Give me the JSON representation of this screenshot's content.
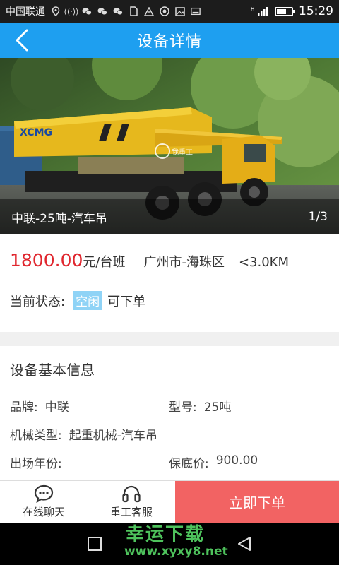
{
  "status_bar": {
    "carrier": "中国联通",
    "time": "15:29"
  },
  "header": {
    "title": "设备详情"
  },
  "photo": {
    "caption": "中联-25吨-汽车吊",
    "page_indicator": "1/3",
    "crane_logo": "XCMG",
    "watermark_logo": "我重工"
  },
  "price": {
    "amount": "1800.00",
    "unit": "元/台班",
    "location": "广州市-海珠区",
    "distance": "<3.0KM"
  },
  "status": {
    "label": "当前状态:",
    "badge": "空闲",
    "note": "可下单"
  },
  "basic_info": {
    "title": "设备基本信息",
    "rows": [
      [
        {
          "label": "品牌:",
          "value": "中联"
        },
        {
          "label": "型号:",
          "value": "25吨"
        }
      ],
      [
        {
          "label": "机械类型:",
          "value": "起重机械-汽车吊"
        },
        {
          "label": "",
          "value": ""
        }
      ],
      [
        {
          "label": "出场年份:",
          "value": ""
        },
        {
          "label": "保底价:",
          "value": "900.00"
        }
      ]
    ]
  },
  "actions": {
    "chat": "在线聊天",
    "service": "重工客服",
    "order": "立即下单"
  },
  "watermark": {
    "text": "幸运下载",
    "url": "www.xyxy8.net"
  }
}
